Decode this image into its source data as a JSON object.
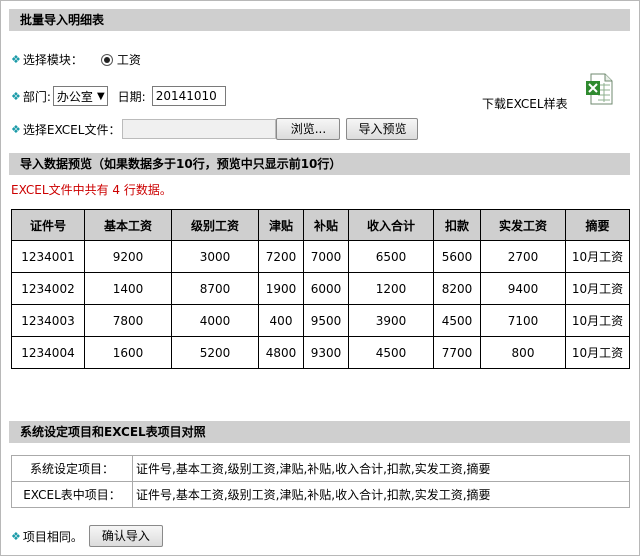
{
  "header": {
    "title": "批量导入明细表"
  },
  "module": {
    "label": "选择模块：",
    "option": "工资"
  },
  "dept": {
    "label": "部门:",
    "value": "办公室",
    "date_label": "日期:",
    "date_value": "20141010"
  },
  "download": {
    "label": "下载EXCEL样表"
  },
  "file": {
    "label": "选择EXCEL文件：",
    "browse": "浏览...",
    "preview": "导入预览"
  },
  "preview_section": {
    "title": "导入数据预览（如果数据多于10行，预览中只显示前10行）",
    "count_msg": "EXCEL文件中共有 4 行数据。"
  },
  "table": {
    "headers": [
      "证件号",
      "基本工资",
      "级别工资",
      "津贴",
      "补贴",
      "收入合计",
      "扣款",
      "实发工资",
      "摘要"
    ],
    "rows": [
      [
        "1234001",
        "9200",
        "3000",
        "7200",
        "7000",
        "6500",
        "5600",
        "2700",
        "10月工资"
      ],
      [
        "1234002",
        "1400",
        "8700",
        "1900",
        "6000",
        "1200",
        "8200",
        "9400",
        "10月工资"
      ],
      [
        "1234003",
        "7800",
        "4000",
        "400",
        "9500",
        "3900",
        "4500",
        "7100",
        "10月工资"
      ],
      [
        "1234004",
        "1600",
        "5200",
        "4800",
        "9300",
        "4500",
        "7700",
        "800",
        "10月工资"
      ]
    ]
  },
  "mapping": {
    "title": "系统设定项目和EXCEL表项目对照",
    "rows": [
      {
        "key": "系统设定项目：",
        "value": "证件号,基本工资,级别工资,津贴,补贴,收入合计,扣款,实发工资,摘要"
      },
      {
        "key": "EXCEL表中项目：",
        "value": "证件号,基本工资,级别工资,津贴,补贴,收入合计,扣款,实发工资,摘要"
      }
    ]
  },
  "footer": {
    "same_label": "项目相同。",
    "confirm": "确认导入"
  },
  "icons": {
    "bullet": "diamond-icon",
    "excel": "excel-file-icon"
  },
  "colors": {
    "section_bar": "#cfcfcf",
    "bullet": "#1a9aa8",
    "alert": "#cc0000"
  }
}
